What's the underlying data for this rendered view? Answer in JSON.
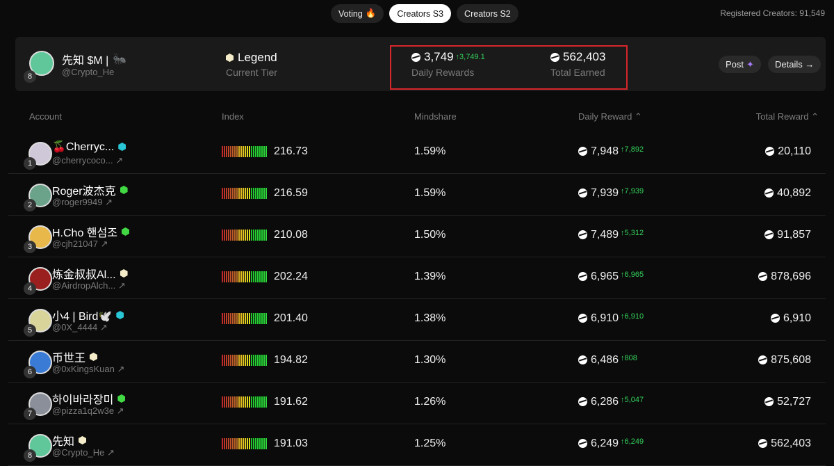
{
  "tabs": [
    {
      "label": "Voting",
      "icon": "fire-icon",
      "active": false
    },
    {
      "label": "Creators S3",
      "active": true
    },
    {
      "label": "Creators S2",
      "active": false
    }
  ],
  "registered": "Registered Creators: 91,549",
  "me": {
    "rank": "8",
    "name": "先知 $M |",
    "emoji": "🐜",
    "handle": "@Crypto_He",
    "tier": "Legend",
    "tier_label": "Current Tier",
    "daily": "3,749",
    "daily_delta": "3,749.1",
    "daily_label": "Daily Rewards",
    "total": "562,403",
    "total_label": "Total Earned",
    "post": "Post",
    "details": "Details →"
  },
  "headers": {
    "account": "Account",
    "index": "Index",
    "mindshare": "Mindshare",
    "daily": "Daily Reward ⌃",
    "total": "Total Reward ⌃"
  },
  "colors": {
    "cyan": "#29c6d6",
    "green": "#41d843",
    "legend": "#f4ecc9",
    "up": "#33d15a",
    "highlight": "#d6262b"
  },
  "rows": [
    {
      "rank": "1",
      "name": "🍒Cherryc...",
      "handle": "@cherrycoco...",
      "badge": "cyan",
      "index": "216.73",
      "mindshare": "1.59%",
      "daily": "7,948",
      "delta": "7,892",
      "total": "20,110",
      "av": "#cfc8d8"
    },
    {
      "rank": "2",
      "name": "Roger波杰克",
      "handle": "@roger9949",
      "badge": "green",
      "index": "216.59",
      "mindshare": "1.59%",
      "daily": "7,939",
      "delta": "7,939",
      "total": "40,892",
      "av": "#6aa38a"
    },
    {
      "rank": "3",
      "name": "H.Cho 핸섬조",
      "handle": "@cjh21047",
      "badge": "green",
      "index": "210.08",
      "mindshare": "1.50%",
      "daily": "7,489",
      "delta": "5,312",
      "total": "91,857",
      "av": "#e8b84a"
    },
    {
      "rank": "4",
      "name": "炼金叔叔Al...",
      "handle": "@AirdropAlch...",
      "badge": "legend",
      "index": "202.24",
      "mindshare": "1.39%",
      "daily": "6,965",
      "delta": "6,965",
      "total": "878,696",
      "av": "#9a1f1f"
    },
    {
      "rank": "5",
      "name": "小4 | Bird🕊️",
      "handle": "@0X_4444",
      "badge": "cyan",
      "index": "201.40",
      "mindshare": "1.38%",
      "daily": "6,910",
      "delta": "6,910",
      "total": "6,910",
      "av": "#d8d49a"
    },
    {
      "rank": "6",
      "name": "币世王",
      "handle": "@0xKingsKuan",
      "badge": "legend",
      "index": "194.82",
      "mindshare": "1.30%",
      "daily": "6,486",
      "delta": "808",
      "total": "875,608",
      "av": "#3a7bd5"
    },
    {
      "rank": "7",
      "name": "하이바라장미",
      "handle": "@pizza1q2w3e",
      "badge": "green",
      "index": "191.62",
      "mindshare": "1.26%",
      "daily": "6,286",
      "delta": "5,047",
      "total": "52,727",
      "av": "#8a8f9a"
    },
    {
      "rank": "8",
      "name": "先知",
      "handle": "@Crypto_He",
      "badge": "legend",
      "index": "191.03",
      "mindshare": "1.25%",
      "daily": "6,249",
      "delta": "6,249",
      "total": "562,403",
      "av": "#5fc79a"
    }
  ]
}
